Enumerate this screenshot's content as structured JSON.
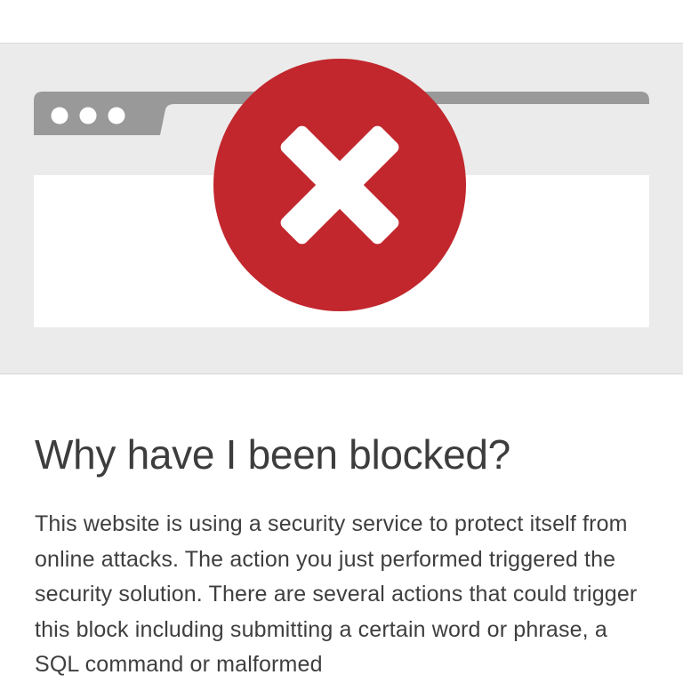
{
  "illustration": {
    "browser_dots_icon": "window-controls-dots",
    "error_icon": "close-x-icon",
    "error_color": "#c1272d",
    "chrome_color": "#999999",
    "band_color": "#ebebeb"
  },
  "block_page": {
    "heading": "Why have I been blocked?",
    "explanation": "This website is using a security service to protect itself from online attacks. The action you just performed triggered the security solution. There are several actions that could trigger this block including submitting a certain word or phrase, a SQL command or malformed"
  }
}
